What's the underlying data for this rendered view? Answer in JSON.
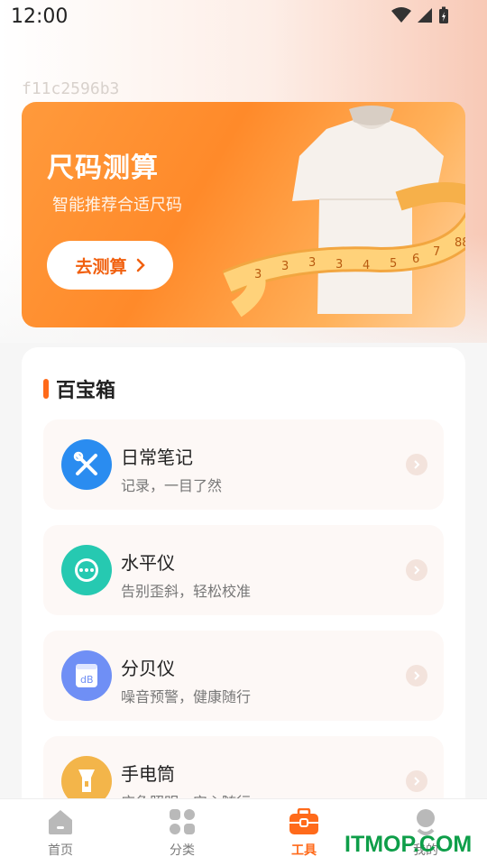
{
  "status_bar": {
    "time": "12:00"
  },
  "watermark_text": "f11c2596b3",
  "banner": {
    "title": "尺码测算",
    "subtitle": "智能推荐合适尺码",
    "button_label": "去测算",
    "accent": "#ff8a2a"
  },
  "toolbox": {
    "title": "百宝箱",
    "items": [
      {
        "name": "日常笔记",
        "desc": "记录，一目了然",
        "icon": "wrench-screwdriver-icon",
        "color": "#2a8cf0"
      },
      {
        "name": "水平仪",
        "desc": "告别歪斜，轻松校准",
        "icon": "level-icon",
        "color": "#26c9b1"
      },
      {
        "name": "分贝仪",
        "desc": "噪音预警，健康随行",
        "icon": "decibel-meter-icon",
        "color": "#6f8ff5"
      },
      {
        "name": "手电筒",
        "desc": "应急照明，安心随行",
        "icon": "flashlight-icon",
        "color": "#f3b54a"
      }
    ]
  },
  "tabbar": {
    "tabs": [
      {
        "label": "首页",
        "icon": "home-icon"
      },
      {
        "label": "分类",
        "icon": "grid-icon"
      },
      {
        "label": "工具",
        "icon": "toolbox-icon",
        "active": true
      },
      {
        "label": "我的",
        "icon": "profile-icon"
      }
    ],
    "active_color": "#ff6a1a"
  },
  "overlay_logo": "ITMOP.COM"
}
